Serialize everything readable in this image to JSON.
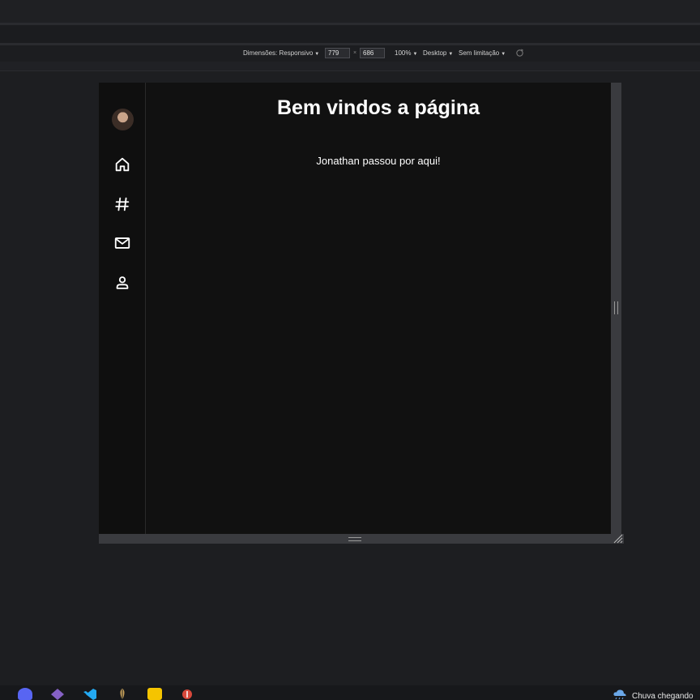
{
  "devtools": {
    "dimensions_label": "Dimensões: Responsivo",
    "width_value": "779",
    "times_symbol": "×",
    "height_value": "686",
    "zoom_label": "100%",
    "device_type_label": "Desktop",
    "throttle_label": "Sem limitação",
    "dropdown_arrow": "▼"
  },
  "page": {
    "title": "Bem vindos a página",
    "text": "Jonathan passou por aqui!"
  },
  "sidebar": {
    "items": [
      {
        "icon": "home-icon"
      },
      {
        "icon": "hash-icon"
      },
      {
        "icon": "mail-icon"
      },
      {
        "icon": "user-icon"
      }
    ]
  },
  "taskbar": {
    "apps": [
      "discord-icon",
      "visual-studio-icon",
      "vscode-icon",
      "game-icon",
      "file-manager-icon",
      "app-icon"
    ],
    "weather_text": "Chuva chegando"
  },
  "colors": {
    "background": "#1d1e21",
    "viewport": "#111111",
    "text": "#ffffff"
  }
}
